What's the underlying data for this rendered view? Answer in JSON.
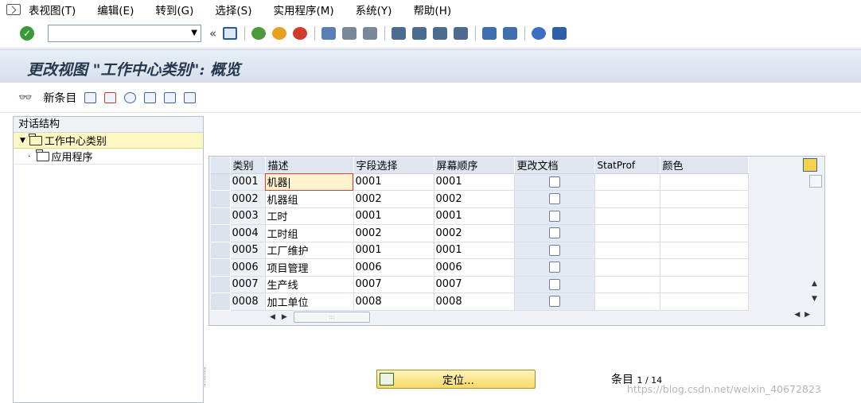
{
  "menubar": {
    "items": [
      "表视图(T)",
      "编辑(E)",
      "转到(G)",
      "选择(S)",
      "实用程序(M)",
      "系统(Y)",
      "帮助(H)"
    ]
  },
  "systoolbar": {
    "command_value": "",
    "back_double_arrow": "«"
  },
  "title": "更改视图 \"工作中心类别\": 概览",
  "apptoolbar": {
    "new_entry_label": "新条目"
  },
  "dialog_structure": {
    "header": "对话结构",
    "items": [
      {
        "label": "工作中心类别",
        "selected": true
      },
      {
        "label": "应用程序",
        "selected": false
      }
    ]
  },
  "table": {
    "columns": [
      "类别",
      "描述",
      "字段选择",
      "屏幕顺序",
      "更改文档",
      "StatProf",
      "颜色"
    ],
    "rows": [
      {
        "category": "0001",
        "description": "机器",
        "field_sel": "0001",
        "screen_seq": "0001",
        "change_doc": false,
        "statprof": "",
        "color": ""
      },
      {
        "category": "0002",
        "description": "机器组",
        "field_sel": "0002",
        "screen_seq": "0002",
        "change_doc": false,
        "statprof": "",
        "color": ""
      },
      {
        "category": "0003",
        "description": "工时",
        "field_sel": "0001",
        "screen_seq": "0001",
        "change_doc": false,
        "statprof": "",
        "color": ""
      },
      {
        "category": "0004",
        "description": "工时组",
        "field_sel": "0002",
        "screen_seq": "0002",
        "change_doc": false,
        "statprof": "",
        "color": ""
      },
      {
        "category": "0005",
        "description": "工厂维护",
        "field_sel": "0001",
        "screen_seq": "0001",
        "change_doc": false,
        "statprof": "",
        "color": ""
      },
      {
        "category": "0006",
        "description": "项目管理",
        "field_sel": "0006",
        "screen_seq": "0006",
        "change_doc": false,
        "statprof": "",
        "color": ""
      },
      {
        "category": "0007",
        "description": "生产线",
        "field_sel": "0007",
        "screen_seq": "0007",
        "change_doc": false,
        "statprof": "",
        "color": ""
      },
      {
        "category": "0008",
        "description": "加工单位",
        "field_sel": "0008",
        "screen_seq": "0008",
        "change_doc": false,
        "statprof": "",
        "color": ""
      }
    ]
  },
  "footer": {
    "locate_button": "定位...",
    "entry_label": "条目",
    "entry_count": "1 / 14",
    "watermark": "https://blog.csdn.net/weixin_40672823"
  },
  "colors": {
    "selection_yellow": "#fff7c2",
    "title_color": "#23374f",
    "button_yellow": "#f6d968"
  }
}
